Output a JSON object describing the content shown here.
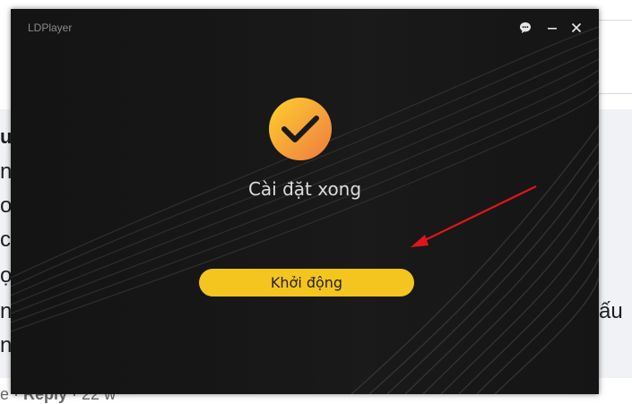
{
  "dialog": {
    "app_title": "LDPlayer",
    "status_text": "Cài đặt xong",
    "launch_button_label": "Khởi động",
    "icons": {
      "feedback": "chat-bubble-icon",
      "minimize": "minimize-icon",
      "close": "close-icon",
      "success": "checkmark-circle-icon"
    },
    "colors": {
      "window_bg": "#141414",
      "accent": "#f4c41f",
      "check_gradient_start": "#ffd02a",
      "check_gradient_end": "#f07a3e",
      "annotation_arrow": "#e0141e"
    }
  },
  "background_page": {
    "left_letters": [
      "u",
      "n",
      "o",
      "c",
      "ọ",
      "n",
      "n"
    ],
    "right_text": "ấu",
    "footer": {
      "prefix": "e · ",
      "reply_label": "Reply",
      "time": " · 22 w"
    }
  }
}
